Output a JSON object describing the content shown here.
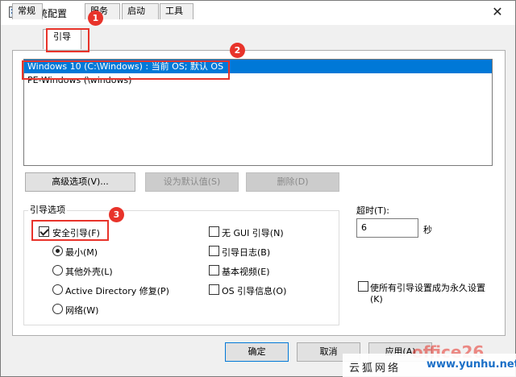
{
  "window": {
    "title": "系统配置",
    "close_glyph": "✕"
  },
  "tabs": [
    {
      "label": "常规"
    },
    {
      "label": "引导"
    },
    {
      "label": "服务"
    },
    {
      "label": "启动"
    },
    {
      "label": "工具"
    }
  ],
  "active_tab": "引导",
  "os_list": [
    {
      "label": "Windows 10 (C:\\Windows) : 当前 OS; 默认 OS",
      "selected": true
    },
    {
      "label": "PE-Windows (\\windows)",
      "selected": false
    }
  ],
  "buttons": {
    "advanced": "高级选项(V)...",
    "set_default": "设为默认值(S)",
    "delete": "删除(D)"
  },
  "boot_options": {
    "group_label": "引导选项",
    "safe_boot": {
      "label": "安全引导(F)",
      "checked": true
    },
    "minimal": {
      "label": "最小(M)",
      "checked": true
    },
    "alternate_shell": {
      "label": "其他外壳(L)",
      "checked": false
    },
    "active_directory": {
      "label": "Active Directory 修复(P)",
      "checked": false
    },
    "network": {
      "label": "网络(W)",
      "checked": false
    },
    "no_gui": {
      "label": "无 GUI 引导(N)",
      "checked": false
    },
    "boot_log": {
      "label": "引导日志(B)",
      "checked": false
    },
    "base_video": {
      "label": "基本视频(E)",
      "checked": false
    },
    "os_info": {
      "label": "OS 引导信息(O)",
      "checked": false
    }
  },
  "timeout": {
    "label": "超时(T):",
    "value": "6",
    "unit": "秒"
  },
  "permanent": {
    "label": "使所有引导设置成为永久设置",
    "label_suffix": "(K)",
    "checked": false
  },
  "footer": {
    "ok": "确定",
    "cancel": "取消",
    "apply": "应用(A)"
  },
  "annotations": {
    "marker1": "1",
    "marker2": "2",
    "marker3": "3",
    "color": "#e8332a"
  },
  "watermark": {
    "cn": "云狐网络",
    "url": "www.yunhu.net",
    "office": "office26"
  },
  "colors": {
    "selection": "#0078d7",
    "dialog_bg": "#f0f0f0"
  }
}
